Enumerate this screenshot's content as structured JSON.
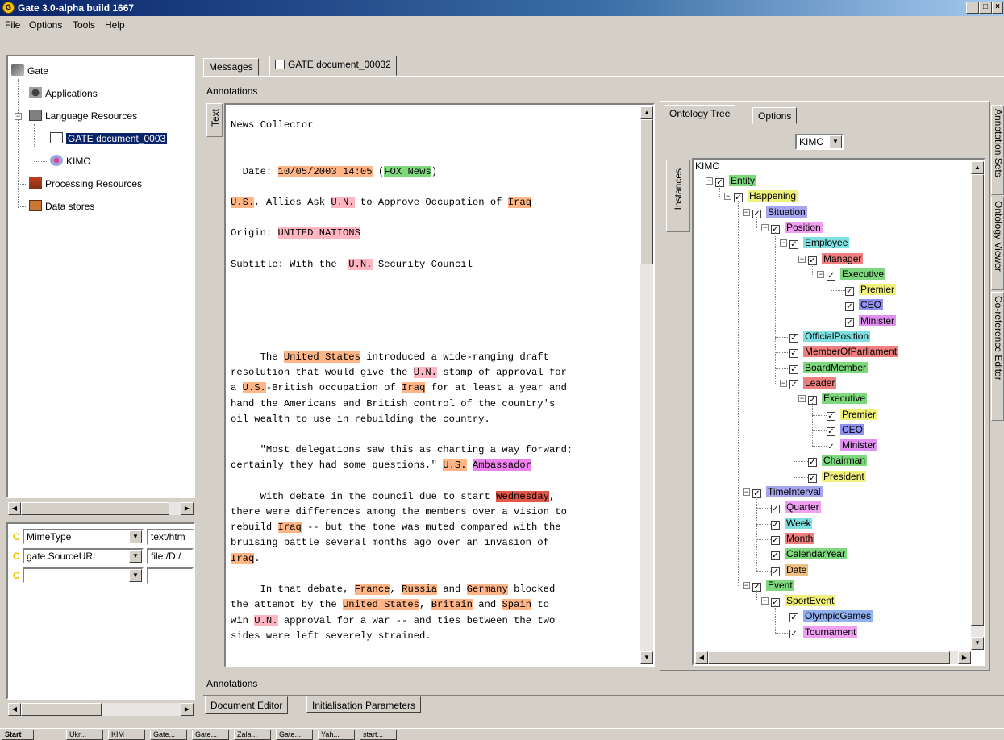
{
  "window": {
    "title": "Gate 3.0-alpha build 1667",
    "min": "_",
    "max": "□",
    "close": "×"
  },
  "menu": [
    "File",
    "Options",
    "Tools",
    "Help"
  ],
  "resource_tree": {
    "root": "Gate",
    "applications": "Applications",
    "language_resources": "Language Resources",
    "doc": "GATE document_0003",
    "kimo": "KIMO",
    "processing_resources": "Processing Resources",
    "data_stores": "Data stores"
  },
  "features": [
    {
      "marker": "C",
      "key": "MimeType",
      "value": "text/htm"
    },
    {
      "marker": "C",
      "key": "gate.SourceURL",
      "value": "file:/D:/"
    },
    {
      "marker": "C",
      "key": "",
      "value": ""
    }
  ],
  "top_tabs": {
    "messages": "Messages",
    "document": "GATE document_00032"
  },
  "annotations_label": "Annotations",
  "text_tab": "Text",
  "document": {
    "lines": [
      [
        [
          "News Collector",
          ""
        ]
      ],
      [],
      [],
      [
        [
          "  Date: ",
          ""
        ],
        [
          "10/05/2003 14:05",
          "or"
        ],
        [
          " (",
          ""
        ],
        [
          "FOX News",
          "gr"
        ],
        [
          ")",
          ""
        ]
      ],
      [],
      [
        [
          "U.S.",
          "or"
        ],
        [
          ", Allies Ask ",
          ""
        ],
        [
          "U.N.",
          "pk"
        ],
        [
          " to Approve Occupation of ",
          ""
        ],
        [
          "Iraq",
          "or"
        ]
      ],
      [],
      [
        [
          "Origin: ",
          ""
        ],
        [
          "UNITED NATIONS",
          "pk"
        ]
      ],
      [],
      [
        [
          "Subtitle: With the  ",
          ""
        ],
        [
          "U.N.",
          "pk"
        ],
        [
          " Security Council",
          ""
        ]
      ],
      [],
      [],
      [],
      [],
      [],
      [
        [
          "     The ",
          ""
        ],
        [
          "United States",
          "or"
        ],
        [
          " introduced a wide-ranging draft",
          ""
        ]
      ],
      [
        [
          "resolution that would give the ",
          ""
        ],
        [
          "U.N.",
          "pk"
        ],
        [
          " stamp of approval for",
          ""
        ]
      ],
      [
        [
          "a ",
          ""
        ],
        [
          "U.S.",
          "or"
        ],
        [
          "-British occupation of ",
          ""
        ],
        [
          "Iraq",
          "or"
        ],
        [
          " for at least a year and",
          ""
        ]
      ],
      [
        [
          "hand the Americans and British control of the country's",
          ""
        ]
      ],
      [
        [
          "oil wealth to use in rebuilding the country.",
          ""
        ]
      ],
      [],
      [
        [
          "     \"Most delegations saw this as charting a way forward;",
          ""
        ]
      ],
      [
        [
          "certainly they had some questions,\" ",
          ""
        ],
        [
          "U.S.",
          "or"
        ],
        [
          " ",
          ""
        ],
        [
          "Ambassador",
          "mg"
        ]
      ],
      [],
      [
        [
          "     With debate in the council due to start ",
          ""
        ],
        [
          "Wednesday",
          "rd"
        ],
        [
          ",",
          ""
        ]
      ],
      [
        [
          "there were differences among the members over a vision to",
          ""
        ]
      ],
      [
        [
          "rebuild ",
          ""
        ],
        [
          "Iraq",
          "or"
        ],
        [
          " -- but the tone was muted compared with the",
          ""
        ]
      ],
      [
        [
          "bruising battle several months ago over an invasion of",
          ""
        ]
      ],
      [
        [
          "Iraq",
          "or"
        ],
        [
          ".",
          ""
        ]
      ],
      [],
      [
        [
          "     In that debate, ",
          ""
        ],
        [
          "France",
          "or"
        ],
        [
          ", ",
          ""
        ],
        [
          "Russia",
          "or"
        ],
        [
          " and ",
          ""
        ],
        [
          "Germany",
          "or"
        ],
        [
          " blocked",
          ""
        ]
      ],
      [
        [
          "the attempt by the ",
          ""
        ],
        [
          "United States",
          "or"
        ],
        [
          ", ",
          ""
        ],
        [
          "Britain",
          "or"
        ],
        [
          " and ",
          ""
        ],
        [
          "Spain",
          "or"
        ],
        [
          " to",
          ""
        ]
      ],
      [
        [
          "win ",
          ""
        ],
        [
          "U.N.",
          "pk"
        ],
        [
          " approval for a war -- and ties between the two",
          ""
        ]
      ],
      [
        [
          "sides were left severely strained.",
          ""
        ]
      ]
    ]
  },
  "ontology_tabs": {
    "tree": "Ontology Tree",
    "options": "Options"
  },
  "ontology_select": "KIMO",
  "instances_tab": "Instances",
  "ontology": {
    "root": "KIMO",
    "nodes": [
      {
        "label": "Entity",
        "depth": 1,
        "color": "#7ed87e",
        "exp": true
      },
      {
        "label": "Happening",
        "depth": 2,
        "color": "#f0f07a",
        "exp": true
      },
      {
        "label": "Situation",
        "depth": 3,
        "color": "#a6a6f0",
        "exp": true
      },
      {
        "label": "Position",
        "depth": 4,
        "color": "#f0a0f0",
        "exp": true
      },
      {
        "label": "Employee",
        "depth": 5,
        "color": "#7ee0e0",
        "exp": true
      },
      {
        "label": "Manager",
        "depth": 6,
        "color": "#f08080",
        "exp": true
      },
      {
        "label": "Executive",
        "depth": 7,
        "color": "#7ed87e",
        "exp": true
      },
      {
        "label": "Premier",
        "depth": 8,
        "color": "#f0f07a",
        "exp": false
      },
      {
        "label": "CEO",
        "depth": 8,
        "color": "#9090f0",
        "exp": false
      },
      {
        "label": "Minister",
        "depth": 8,
        "color": "#e090f0",
        "exp": false
      },
      {
        "label": "OfficialPosition",
        "depth": 5,
        "color": "#7ee0e0",
        "exp": false
      },
      {
        "label": "MemberOfParliament",
        "depth": 5,
        "color": "#f08080",
        "exp": false
      },
      {
        "label": "BoardMember",
        "depth": 5,
        "color": "#7ed87e",
        "exp": false
      },
      {
        "label": "Leader",
        "depth": 5,
        "color": "#f08080",
        "exp": true
      },
      {
        "label": "Executive",
        "depth": 6,
        "color": "#7ed87e",
        "exp": true
      },
      {
        "label": "Premier",
        "depth": 7,
        "color": "#f0f07a",
        "exp": false
      },
      {
        "label": "CEO",
        "depth": 7,
        "color": "#9090f0",
        "exp": false
      },
      {
        "label": "Minister",
        "depth": 7,
        "color": "#e090f0",
        "exp": false
      },
      {
        "label": "Chairman",
        "depth": 6,
        "color": "#7ed87e",
        "exp": false
      },
      {
        "label": "President",
        "depth": 6,
        "color": "#f0f07a",
        "exp": false
      },
      {
        "label": "TimeInterval",
        "depth": 3,
        "color": "#a6a6f0",
        "exp": true
      },
      {
        "label": "Quarter",
        "depth": 4,
        "color": "#f0a0f0",
        "exp": false
      },
      {
        "label": "Week",
        "depth": 4,
        "color": "#7ee0e0",
        "exp": false
      },
      {
        "label": "Month",
        "depth": 4,
        "color": "#f08080",
        "exp": false
      },
      {
        "label": "CalendarYear",
        "depth": 4,
        "color": "#7ed87e",
        "exp": false
      },
      {
        "label": "Date",
        "depth": 4,
        "color": "#f0c080",
        "exp": false
      },
      {
        "label": "Event",
        "depth": 3,
        "color": "#7ed87e",
        "exp": true
      },
      {
        "label": "SportEvent",
        "depth": 4,
        "color": "#f0f07a",
        "exp": true
      },
      {
        "label": "OlympicGames",
        "depth": 5,
        "color": "#90b0f0",
        "exp": false
      },
      {
        "label": "Tournament",
        "depth": 5,
        "color": "#f0a0f0",
        "exp": false
      }
    ]
  },
  "right_vtabs": [
    "Annotation Sets",
    "Ontology Viewer",
    "Co-reference Editor"
  ],
  "bottom_annotations": "Annotations",
  "bottom_tabs": {
    "editor": "Document Editor",
    "init": "Initialisation Parameters"
  },
  "taskbar": [
    "Start",
    "Ukr...",
    "KIM",
    "Gate...",
    "Gate...",
    "Zala...",
    "Gate...",
    "Yah...",
    "start..."
  ]
}
